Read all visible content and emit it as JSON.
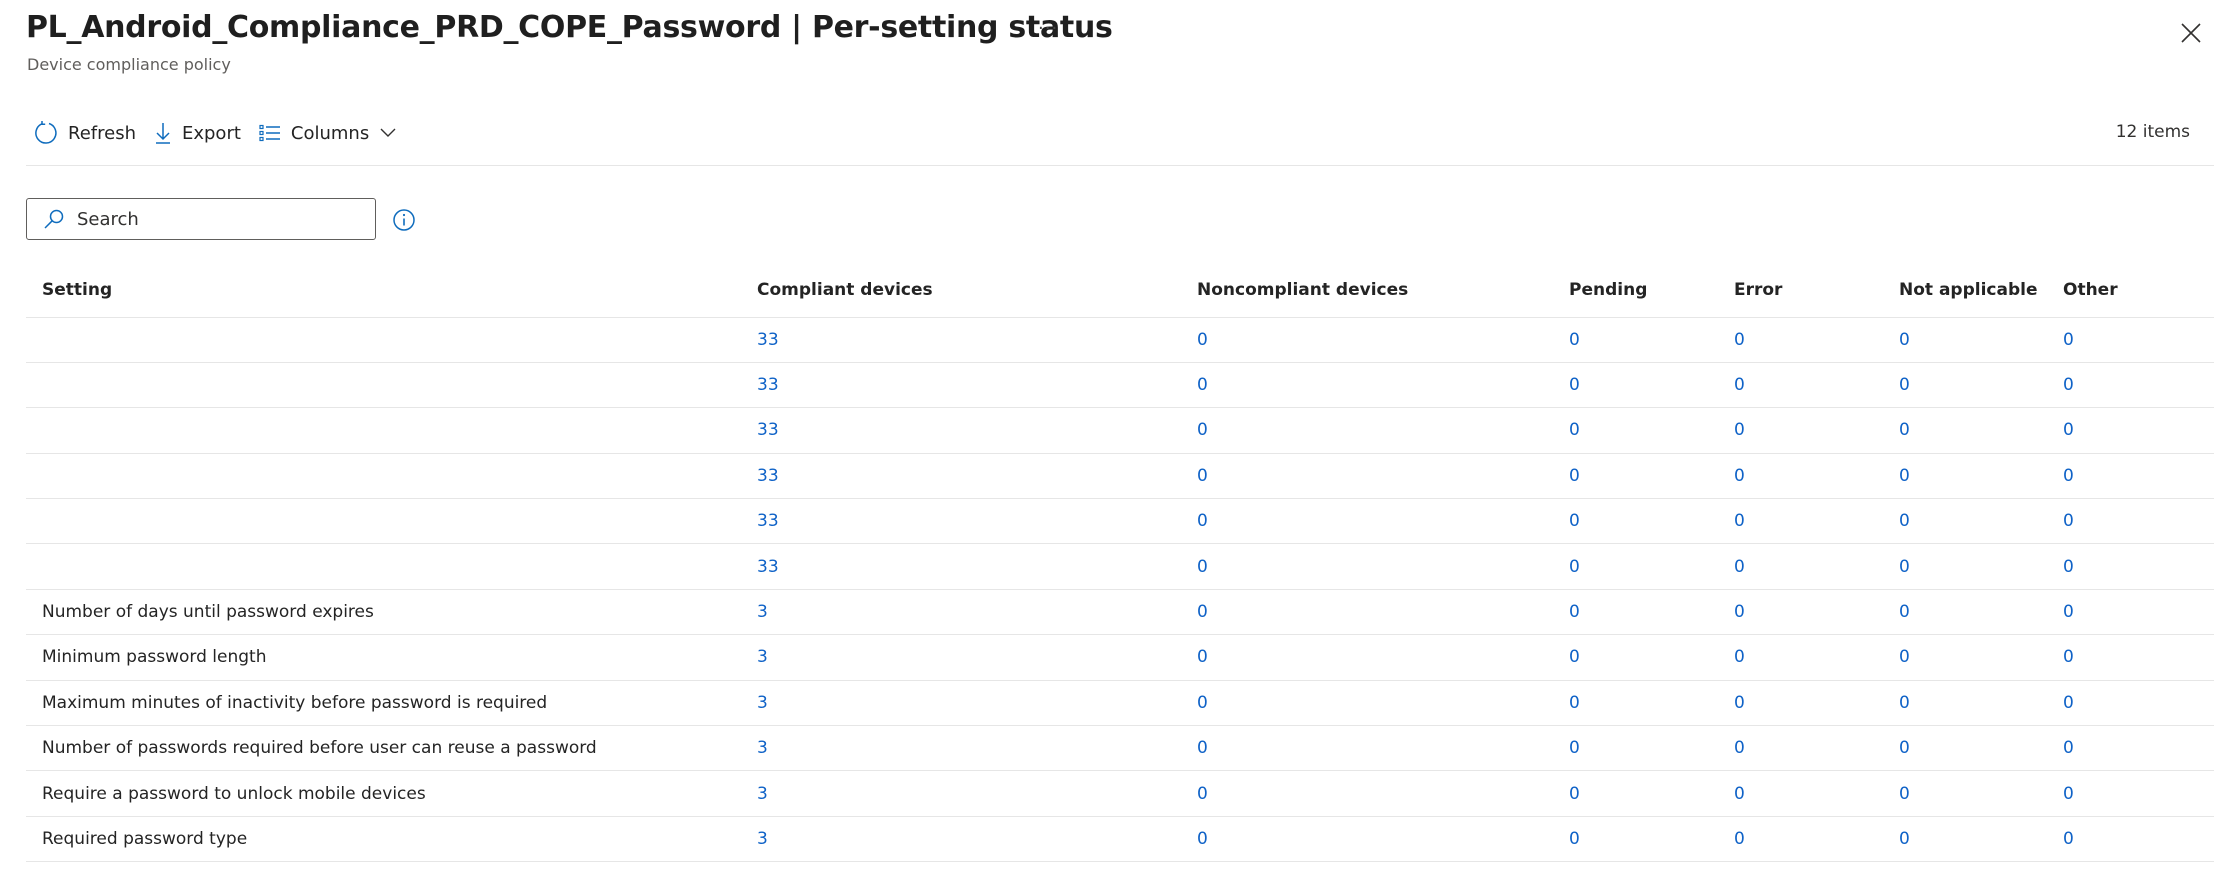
{
  "header": {
    "title": "PL_Android_Compliance_PRD_COPE_Password | Per-setting status",
    "subtitle": "Device compliance policy",
    "more_label": "···",
    "close_icon": "close-icon"
  },
  "toolbar": {
    "refresh_label": "Refresh",
    "export_label": "Export",
    "columns_label": "Columns",
    "items_count": "12 items"
  },
  "search": {
    "placeholder": "Search",
    "value": ""
  },
  "colors": {
    "link": "#0f62c7",
    "icon_accent": "#0f6cbd",
    "text": "#242424",
    "subtle_text": "#605e5c",
    "divider": "#e6e6e6"
  },
  "table": {
    "columns": [
      "Setting",
      "Compliant devices",
      "Noncompliant devices",
      "Pending",
      "Error",
      "Not applicable",
      "Other"
    ],
    "rows": [
      {
        "setting": "",
        "compliant": "33",
        "noncompliant": "0",
        "pending": "0",
        "error": "0",
        "not_applicable": "0",
        "other": "0"
      },
      {
        "setting": "",
        "compliant": "33",
        "noncompliant": "0",
        "pending": "0",
        "error": "0",
        "not_applicable": "0",
        "other": "0"
      },
      {
        "setting": "",
        "compliant": "33",
        "noncompliant": "0",
        "pending": "0",
        "error": "0",
        "not_applicable": "0",
        "other": "0"
      },
      {
        "setting": "",
        "compliant": "33",
        "noncompliant": "0",
        "pending": "0",
        "error": "0",
        "not_applicable": "0",
        "other": "0"
      },
      {
        "setting": "",
        "compliant": "33",
        "noncompliant": "0",
        "pending": "0",
        "error": "0",
        "not_applicable": "0",
        "other": "0"
      },
      {
        "setting": "",
        "compliant": "33",
        "noncompliant": "0",
        "pending": "0",
        "error": "0",
        "not_applicable": "0",
        "other": "0"
      },
      {
        "setting": "Number of days until password expires",
        "compliant": "3",
        "noncompliant": "0",
        "pending": "0",
        "error": "0",
        "not_applicable": "0",
        "other": "0"
      },
      {
        "setting": "Minimum password length",
        "compliant": "3",
        "noncompliant": "0",
        "pending": "0",
        "error": "0",
        "not_applicable": "0",
        "other": "0"
      },
      {
        "setting": "Maximum minutes of inactivity before password is required",
        "compliant": "3",
        "noncompliant": "0",
        "pending": "0",
        "error": "0",
        "not_applicable": "0",
        "other": "0"
      },
      {
        "setting": "Number of passwords required before user can reuse a password",
        "compliant": "3",
        "noncompliant": "0",
        "pending": "0",
        "error": "0",
        "not_applicable": "0",
        "other": "0"
      },
      {
        "setting": "Require a password to unlock mobile devices",
        "compliant": "3",
        "noncompliant": "0",
        "pending": "0",
        "error": "0",
        "not_applicable": "0",
        "other": "0"
      },
      {
        "setting": "Required password type",
        "compliant": "3",
        "noncompliant": "0",
        "pending": "0",
        "error": "0",
        "not_applicable": "0",
        "other": "0"
      }
    ]
  }
}
